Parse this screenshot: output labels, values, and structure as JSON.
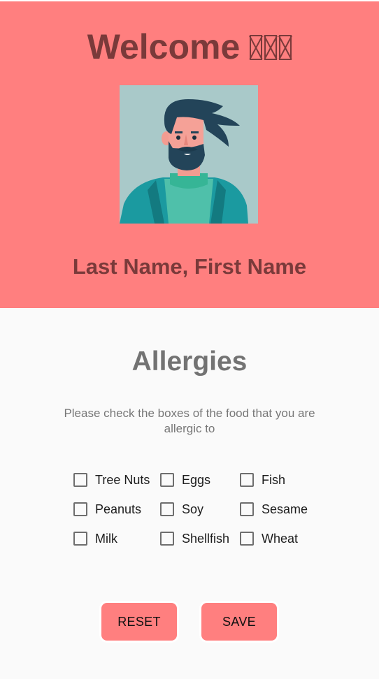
{
  "header": {
    "welcome_text": "Welcome",
    "missing_glyph_count": 3,
    "user_name": "Last Name, First Name",
    "background_color": "#ff7f7f",
    "text_color": "#7a3a3a"
  },
  "allergies": {
    "title": "Allergies",
    "instructions": "Please check the boxes of the food that you are allergic to",
    "items": [
      {
        "label": "Tree Nuts",
        "checked": false
      },
      {
        "label": "Eggs",
        "checked": false
      },
      {
        "label": "Fish",
        "checked": false
      },
      {
        "label": "Peanuts",
        "checked": false
      },
      {
        "label": "Soy",
        "checked": false
      },
      {
        "label": "Sesame",
        "checked": false
      },
      {
        "label": "Milk",
        "checked": false
      },
      {
        "label": "Shellfish",
        "checked": false
      },
      {
        "label": "Wheat",
        "checked": false
      }
    ]
  },
  "actions": {
    "reset_label": "RESET",
    "save_label": "SAVE",
    "button_color": "#ff7f7f"
  },
  "icons": {
    "avatar": "bearded-man-avatar-icon",
    "checkbox": "checkbox-unchecked-icon"
  }
}
